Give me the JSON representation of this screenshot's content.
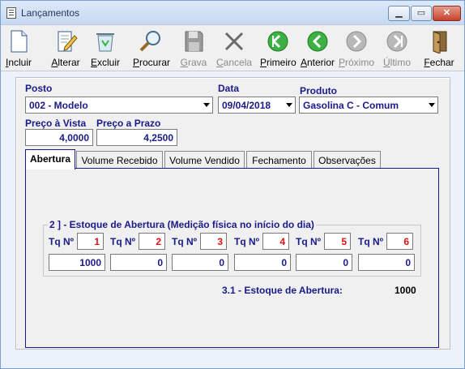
{
  "window": {
    "title": "Lançamentos",
    "min": "▁",
    "max": "▭",
    "close": "✕"
  },
  "toolbar": [
    {
      "label": "Incluir",
      "icon": "new-document-icon",
      "enabled": true
    },
    {
      "label": "Alterar",
      "icon": "edit-document-icon",
      "enabled": true
    },
    {
      "label": "Excluir",
      "icon": "recycle-bin-icon",
      "enabled": true
    },
    {
      "label": "Procurar",
      "icon": "magnifier-icon",
      "enabled": true
    },
    {
      "label": "Grava",
      "icon": "floppy-disk-icon",
      "enabled": false
    },
    {
      "label": "Cancela",
      "icon": "x-cancel-icon",
      "enabled": false
    },
    {
      "label": "Primeiro",
      "icon": "first-arrow-icon",
      "enabled": true
    },
    {
      "label": "Anterior",
      "icon": "previous-arrow-icon",
      "enabled": true
    },
    {
      "label": "Próximo",
      "icon": "next-arrow-icon",
      "enabled": false
    },
    {
      "label": "Último",
      "icon": "last-arrow-icon",
      "enabled": false
    },
    {
      "label": "Fechar",
      "icon": "exit-door-icon",
      "enabled": true
    }
  ],
  "form": {
    "posto_label": "Posto",
    "posto_value": "002 - Modelo",
    "data_label": "Data",
    "data_value": "09/04/2018",
    "produto_label": "Produto",
    "produto_value": "Gasolina C - Comum",
    "preco_vista_label": "Preço à Vista",
    "preco_vista_value": "4,0000",
    "preco_prazo_label": "Preço a Prazo",
    "preco_prazo_value": "4,2500"
  },
  "tabs": [
    "Abertura",
    "Volume Recebido",
    "Volume Vendido",
    "Fechamento",
    "Observações"
  ],
  "abertura": {
    "group_title": "2 ] - Estoque de Abertura (Medição física no início do dia)",
    "tank_label": "Tq Nº",
    "tanks": [
      {
        "num": "1",
        "value": "1000"
      },
      {
        "num": "2",
        "value": "0"
      },
      {
        "num": "3",
        "value": "0"
      },
      {
        "num": "4",
        "value": "0"
      },
      {
        "num": "5",
        "value": "0"
      },
      {
        "num": "6",
        "value": "0"
      }
    ],
    "total_label": "3.1 - Estoque de Abertura:",
    "total_value": "1000"
  },
  "colors": {
    "accent": "#1a1a8a",
    "tank_number": "#e01010",
    "nav_green": "#3cb043"
  }
}
